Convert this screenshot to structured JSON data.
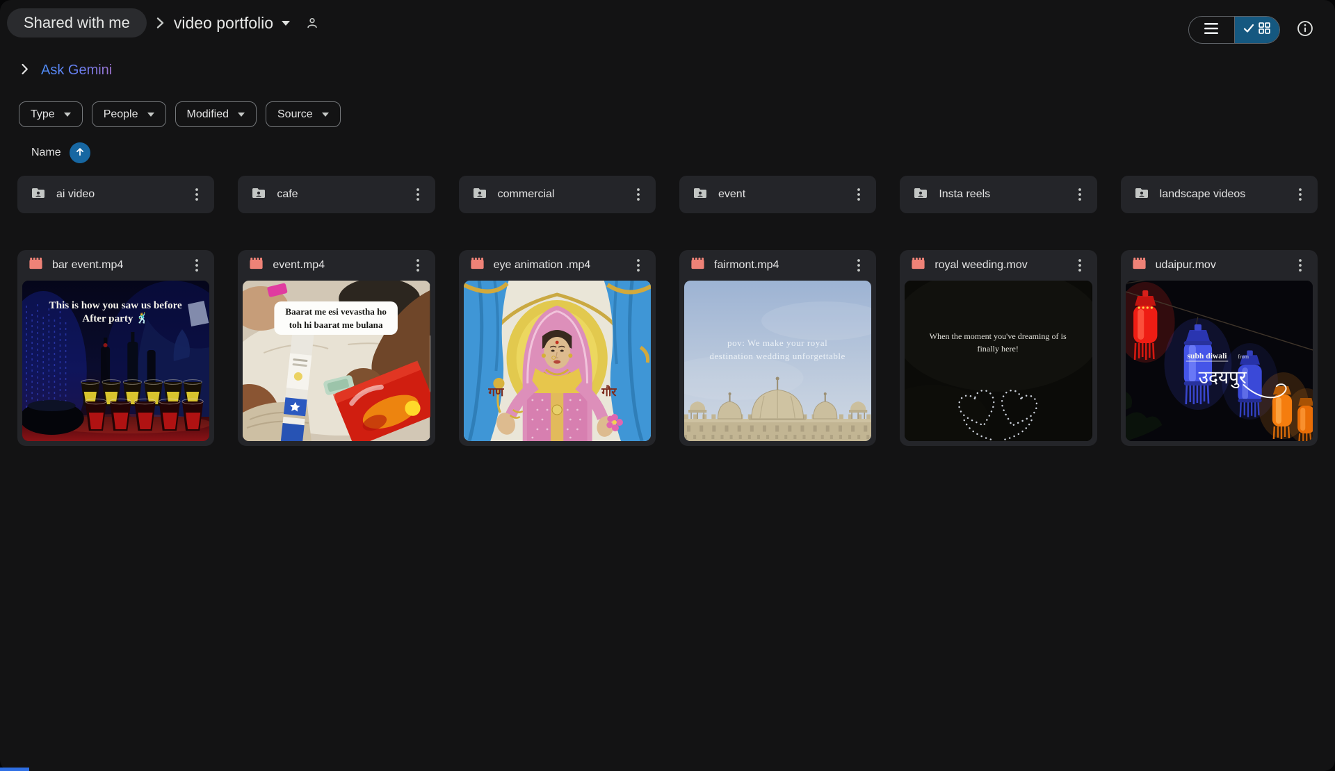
{
  "header": {
    "breadcrumb_root": "Shared with me",
    "title": "video portfolio"
  },
  "gemini": {
    "label": "Ask Gemini"
  },
  "filters": {
    "type": "Type",
    "people": "People",
    "modified": "Modified",
    "source": "Source"
  },
  "sort": {
    "label": "Name",
    "direction": "ascending"
  },
  "folders": [
    {
      "name": "ai video"
    },
    {
      "name": "cafe"
    },
    {
      "name": "commercial"
    },
    {
      "name": "event"
    },
    {
      "name": "Insta reels"
    },
    {
      "name": "landscape videos"
    }
  ],
  "files": [
    {
      "name": "bar event.mp4",
      "overlay_line1": "This is how you saw us before",
      "overlay_line2": "After party 🕺"
    },
    {
      "name": "event.mp4",
      "overlay_line1": "Baarat me esi vevastha ho",
      "overlay_line2": "toh hi baarat me bulana"
    },
    {
      "name": "eye animation .mp4",
      "overlay_left": "गण",
      "overlay_right": "गौर"
    },
    {
      "name": "fairmont.mp4",
      "overlay_line1": "pov: We make your royal",
      "overlay_line2": "destination wedding unforgettable"
    },
    {
      "name": "royal weeding.mov",
      "overlay_line1": "When the moment you've dreaming of is",
      "overlay_line2": "finally here!"
    },
    {
      "name": "udaipur.mov",
      "overlay_small": "subh diwali",
      "overlay_small2": "from",
      "overlay_big": "उदयपुर"
    }
  ],
  "colors": {
    "page_bg": "#131314",
    "card_bg": "#242529",
    "accent_toggle_blue": "#155880",
    "sort_circle_blue": "#1767a2",
    "video_icon_salmon": "#ee8277",
    "gemini_gradient_start": "#4e8df7",
    "gemini_gradient_end": "#9b72cb"
  }
}
